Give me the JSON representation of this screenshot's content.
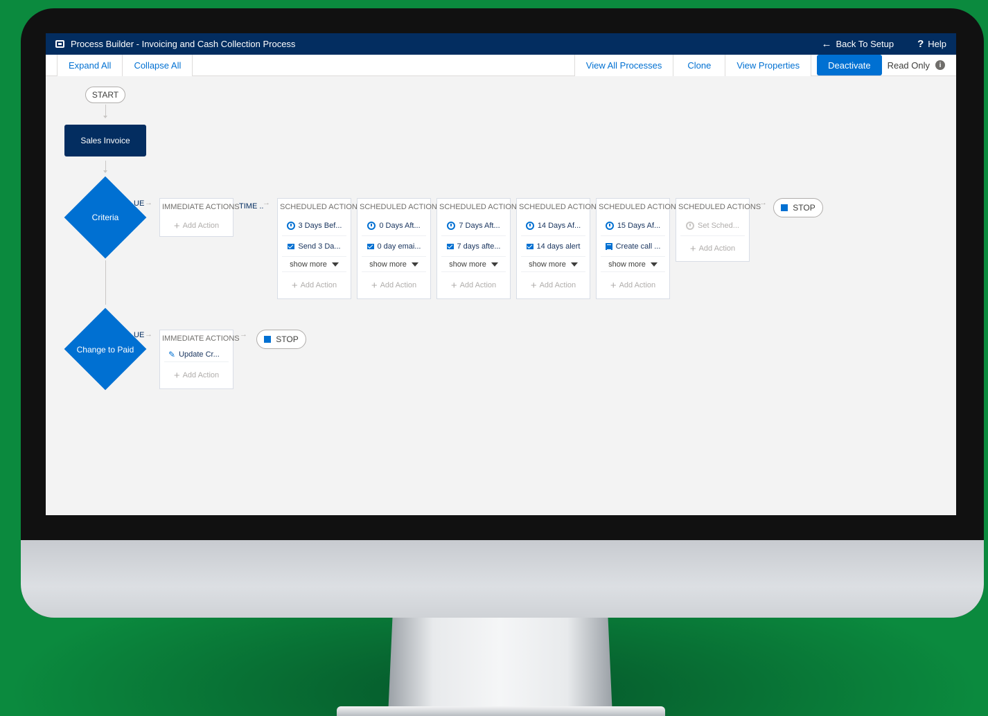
{
  "window": {
    "title": "Process Builder - Invoicing and Cash Collection Process",
    "back_link": "Back To Setup",
    "help_link": "Help"
  },
  "toolbar": {
    "expand_all": "Expand All",
    "collapse_all": "Collapse All",
    "view_all_processes": "View All Processes",
    "clone": "Clone",
    "view_properties": "View Properties",
    "deactivate": "Deactivate",
    "read_only": "Read Only"
  },
  "flow": {
    "start": "START",
    "object_node": "Sales Invoice",
    "criteria": [
      {
        "label": "Criteria",
        "true_label": "UE",
        "immediate": {
          "header": "IMMEDIATE ACTIONS",
          "actions": [],
          "add_action": "Add Action"
        },
        "time_label": "TIME",
        "scheduled": [
          {
            "header": "SCHEDULED ACTION",
            "schedule": "3 Days Bef...",
            "action": "Send 3 Da...",
            "show_more": "show more",
            "add_action": "Add Action",
            "action_type": "email-icon"
          },
          {
            "header": "SCHEDULED ACTION",
            "schedule": "0 Days Aft...",
            "action": "0 day emai...",
            "show_more": "show more",
            "add_action": "Add Action",
            "action_type": "email-icon"
          },
          {
            "header": "SCHEDULED ACTION",
            "schedule": "7 Days Aft...",
            "action": "7 days afte...",
            "show_more": "show more",
            "add_action": "Add Action",
            "action_type": "email-icon"
          },
          {
            "header": "SCHEDULED ACTION",
            "schedule": "14 Days Af...",
            "action": "14 days alert",
            "show_more": "show more",
            "add_action": "Add Action",
            "action_type": "email-icon"
          },
          {
            "header": "SCHEDULED ACTION",
            "schedule": "15 Days Af...",
            "action": "Create call ...",
            "show_more": "show more",
            "add_action": "Add Action",
            "action_type": "task-icon"
          }
        ],
        "empty_scheduled": {
          "header": "SCHEDULED ACTIONS",
          "placeholder": "Set Sched...",
          "add_action": "Add Action"
        },
        "stop": "STOP"
      },
      {
        "label": "Change to Paid",
        "true_label": "UE",
        "immediate": {
          "header": "IMMEDIATE ACTIONS",
          "actions": [
            "Update Cr..."
          ],
          "add_action": "Add Action"
        },
        "stop": "STOP"
      }
    ]
  },
  "colors": {
    "background": "#0b8a3e",
    "titlebar": "#032d60",
    "accent": "#0070d2",
    "canvas": "#f3f3f3"
  }
}
